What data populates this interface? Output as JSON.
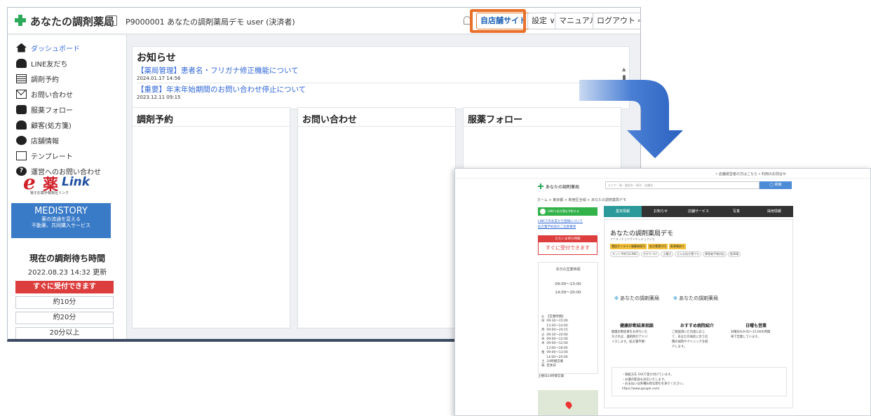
{
  "admin": {
    "brand": "あなたの調剤薬局",
    "store_id": "P9000001 あなたの調剤薬局デモ user (決済者)",
    "toolbar": {
      "shop_site": "自店舗サイト",
      "settings": "設定 ∨",
      "manual": "マニュアル",
      "logout": "ログアウト"
    },
    "sidebar": {
      "items": [
        {
          "label": "ダッシュボード",
          "icon": "home-icon"
        },
        {
          "label": "LINE友だち",
          "icon": "people-icon"
        },
        {
          "label": "調剤予約",
          "icon": "calendar-icon"
        },
        {
          "label": "お問い合わせ",
          "icon": "mail-icon"
        },
        {
          "label": "服薬フォロー",
          "icon": "handshake-icon"
        },
        {
          "label": "顧客(処方箋)",
          "icon": "person-icon"
        },
        {
          "label": "店舗情報",
          "icon": "gear-icon"
        },
        {
          "label": "テンプレート",
          "icon": "document-icon"
        },
        {
          "label": "運営へのお問い合わせ",
          "icon": "question-icon"
        }
      ],
      "elink": {
        "e": "e",
        "kanji": "薬",
        "link": "Link",
        "small": "電子お薬手帳相互リンク"
      },
      "medistory": {
        "title": "MEDISTORY",
        "line1": "薬の流通を変える",
        "line2": "不動薬、共同購入サービス"
      },
      "wait": {
        "title": "現在の調剤待ち時間",
        "updated": "2022.08.23 14:32 更新",
        "options": [
          "すぐに受付できます",
          "約10分",
          "約20分",
          "20分以上"
        ]
      }
    },
    "notice": {
      "title": "お知らせ",
      "items": [
        {
          "text": "【薬局管理】患者名・フリガナ修正機能について",
          "date": "2024.01.17 14:56"
        },
        {
          "text": "【重要】年末年始期間のお問い合わせ停止について",
          "date": "2023.12.11 09:15"
        }
      ]
    },
    "panels": [
      "調剤予約",
      "お問い合わせ",
      "服薬フォロー"
    ]
  },
  "site": {
    "top_links": "• 店舗運営者の方はこちら  • 利用のお問合せ",
    "brand": "あなたの調剤薬局",
    "search_placeholder": "エリア・駅・施設名・駅名・店舗名",
    "search_btn": "◯ 検索",
    "breadcrumb": "ホーム > 東京都 > 新宿区全域 > あなたの調剤薬局デモ",
    "line_btn": "LINEで処方箋を予約する",
    "links": [
      "LINEでのお友だち登録について",
      "処方箋予約前のご注意事項"
    ],
    "accept_head": "ただいま待ち時間",
    "accept_text": "すぐに受付できます",
    "hours_title": "本日の営業時間",
    "hours_main": [
      "09:00～13:00",
      "14:00～20:00"
    ],
    "hours_list": "◎  【営業時間】\n日  09:30～15:00\n     13:30～14:00\n月  09:00～20:15\n火  09:30～20:00\n水  09:00～12:00\n木  09:00～12:00\n     13:00～18:00\n金  09:00～13:00\n     14:00～20:00\n土  24時間営業\n祝  定休日",
    "note": "土曜日24時間営業",
    "tabs": [
      "基本情報",
      "お知らせ",
      "店舗サービス",
      "写真",
      "採用情報"
    ],
    "shop_name": "あなたの調剤薬局デモ",
    "shop_kana": "アナタノチョウザイヤッキョクデモ",
    "tags": [
      "電話オンライン服薬指導可",
      "処方箋受付可",
      "駐車場あり"
    ],
    "chips": [
      "ネット予約可(LINE)",
      "かかりつけ",
      "土曜日",
      "どんな処方箋でも",
      "障害者手帳対応",
      "駐車場"
    ],
    "logo_text": "あなたの調剤薬局",
    "features": [
      {
        "title": "健康診断結果相談",
        "text": "健康診断結果をお持ちいた\nだければ、薬剤師がアドバ\nイスします。処方箋不要！"
      },
      {
        "title": "おすすめ病院紹介",
        "text": "ご相談頂いた内容に応じ\nて、あなたの病症に合う近\n隣の病院やクリニックを紹\n介します。"
      },
      {
        "title": "日曜も営業",
        "text": "日曜日も9:00～15:00の時間\n帯で営業しています。"
      }
    ],
    "info": "・御処方を FAXで受け付けています。\n・お薬の配送も対応いたします。\n・お支払いは各種お得な割引を承りください。\nhttps://www.google.com/"
  }
}
